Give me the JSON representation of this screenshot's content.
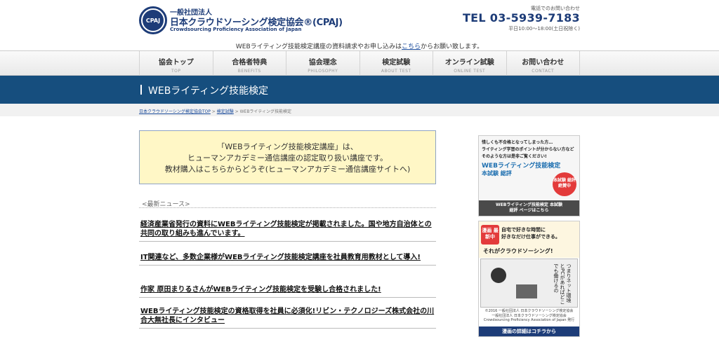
{
  "header": {
    "logo_mark": "CPAJ",
    "org_type": "一般社団法人",
    "org_name": "日本クラウドソーシング検定協会®(CPAJ)",
    "org_english": "Crowdsourcing Proficiency Association of Japan",
    "phone_label": "電話でのお問い合わせ",
    "phone": "TEL 03-5939-7183",
    "hours": "平日10:00〜18:00(土日祝除く)"
  },
  "notice": {
    "before": "WEBライティング技能検定講座の資料請求やお申し込みは",
    "link": "こちら",
    "after": "からお願い致します。"
  },
  "nav": {
    "items": [
      {
        "label": "協会トップ",
        "sub": "TOP"
      },
      {
        "label": "合格者特典",
        "sub": "BENEFITS"
      },
      {
        "label": "協会理念",
        "sub": "PHILOSOPHY"
      },
      {
        "label": "検定試験",
        "sub": "ABOUT TEST"
      },
      {
        "label": "オンライン試験",
        "sub": "ONLINE TEST"
      },
      {
        "label": "お問い合わせ",
        "sub": "CONTACT"
      }
    ]
  },
  "page": {
    "title": "WEBライティング技能検定"
  },
  "breadcrumb": {
    "home": "日本クラウドソーシング検定協会TOP",
    "sep1": " > ",
    "parent": "検定試験",
    "sep2": " > ",
    "current": "WEBライティング技能検定"
  },
  "promo": {
    "line1": "「WEBライティング技能検定講座」は、",
    "line2": "ヒューマンアカデミー通信講座の認定取り扱い講座です。",
    "line3": "教材購入はこちらからどうぞ(ヒューマンアカデミー通信講座サイトへ)"
  },
  "news": {
    "heading": "<最新ニュース>",
    "items": [
      "経済産業省発行の資料にWEBライティング技能検定が掲載されました。国や地方自治体との共同の取り組みも進んでいます。",
      "IT関連など、多数企業様がWEBライティング技能検定講座を社員教育用教材として導入!",
      "作家 原田まりるさんがWEBライティング技能検定を受験し合格されました!",
      "WEBライティング技能検定の資格取得を社員に必須化!リビン・テクノロジーズ株式会社の川合大無社長にインタビュー"
    ]
  },
  "sidebar": {
    "banner1": {
      "line1": "惜しくも不合格となってしまった方…",
      "line2": "ライティング学習のポイントが分からない方など",
      "line3": "そのような方は是非ご覧ください!",
      "title": "WEBライティング技能検定",
      "subtitle": "本試験 総評",
      "badge": "本試験 総評 絶賛中",
      "foot1": "WEBライティング技能検定 本試験",
      "foot2": "総評 ページはこちら"
    },
    "banner2": {
      "badge": "漫画 最新中",
      "line1": "自宅で好きな時間に",
      "line2": "好きなだけ仕事ができる。",
      "line3": "それがクラウドソーシング!",
      "vertical": "つまりネット環境とPCがあればどこでも働けるの",
      "copyright": "©2016 一般社団法人 日本クラウドソーシング検定協会",
      "org": "一般社団法人 日本クラウドソーシング検定協会 Crowdsourcing Proficiency Association of Japan 発行",
      "foot": "漫画の詳細はコチラから"
    }
  }
}
